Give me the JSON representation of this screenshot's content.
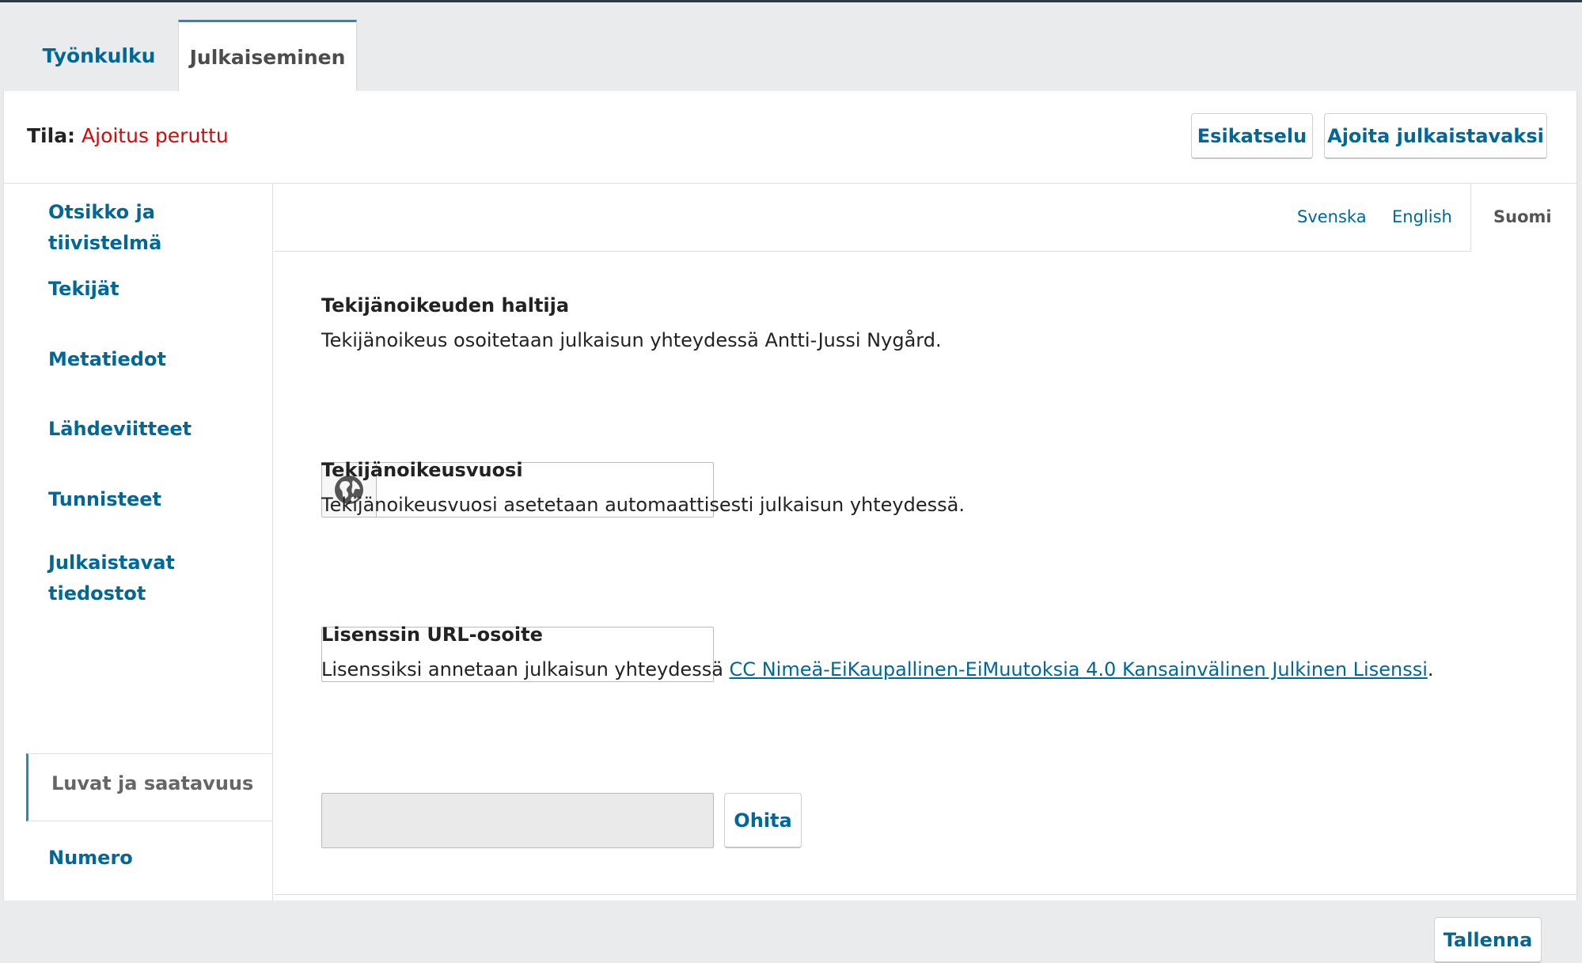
{
  "tabs": [
    {
      "label": "Työnkulku"
    },
    {
      "label": "Julkaiseminen"
    }
  ],
  "header": {
    "status_label": "Tila:",
    "status_value": "Ajoitus peruttu",
    "preview_label": "Esikatselu",
    "schedule_label": "Ajoita julkaistavaksi"
  },
  "sidebar": {
    "items": [
      {
        "label": "Otsikko ja tiivistelmä"
      },
      {
        "label": "Tekijät"
      },
      {
        "label": "Metatiedot"
      },
      {
        "label": "Lähdeviitteet"
      },
      {
        "label": "Tunnisteet"
      },
      {
        "label": "Julkaistavat tiedostot"
      },
      {
        "label": "Luvat ja saatavuus"
      },
      {
        "label": "Numero"
      }
    ],
    "active": "Luvat ja saatavuus"
  },
  "locales": {
    "items": [
      "Svenska",
      "English",
      "Suomi"
    ],
    "active": "Suomi"
  },
  "form": {
    "copyright_holder": {
      "label": "Tekijänoikeuden haltija",
      "description": "Tekijänoikeus osoitetaan julkaisun yhteydessä Antti-Jussi Nygård.",
      "value": ""
    },
    "copyright_year": {
      "label": "Tekijänoikeusvuosi",
      "description": "Tekijänoikeusvuosi asetetaan automaattisesti julkaisun yhteydessä.",
      "value": ""
    },
    "license_url": {
      "label": "Lisenssin URL-osoite",
      "description_prefix": "Lisenssiksi annetaan julkaisun yhteydessä ",
      "license_link": "CC Nimeä-EiKaupallinen-EiMuutoksia 4.0 Kansainvälinen Julkinen Lisenssi",
      "description_suffix": ".",
      "value": "",
      "override_label": "Ohita"
    },
    "save_label": "Tallenna"
  },
  "colors": {
    "link": "#006798",
    "status_error": "#d00a0a",
    "tab_accent": "#1e8bc3"
  }
}
